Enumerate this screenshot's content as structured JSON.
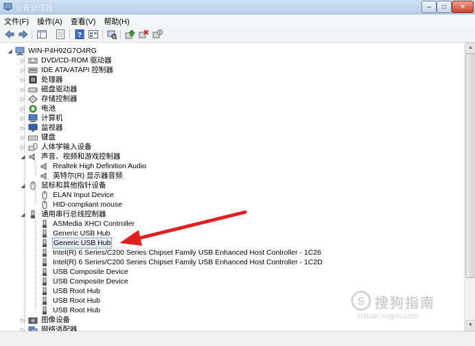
{
  "window": {
    "title": "设备管理器",
    "controls": {
      "minimize": "–",
      "maximize": "□",
      "close": "✕"
    }
  },
  "menu": [
    "文件(F)",
    "操作(A)",
    "查看(V)",
    "帮助(H)"
  ],
  "toolbar_icons": [
    "back-arrow-icon",
    "forward-arrow-icon",
    "console-tree-icon",
    "properties-icon",
    "help-icon",
    "view-icon",
    "scan-hardware-icon",
    "update-driver-icon",
    "uninstall-icon",
    "disable-icon"
  ],
  "tree": {
    "root": "WIN-P4H92G7O4RG",
    "categories": [
      {
        "label": "DVD/CD-ROM 驱动器",
        "icon": "dvd-drive-icon"
      },
      {
        "label": "IDE ATA/ATAPI 控制器",
        "icon": "ide-controller-icon"
      },
      {
        "label": "处理器",
        "icon": "processor-icon"
      },
      {
        "label": "磁盘驱动器",
        "icon": "disk-drive-icon"
      },
      {
        "label": "存储控制器",
        "icon": "storage-controller-icon"
      },
      {
        "label": "电池",
        "icon": "battery-icon"
      },
      {
        "label": "计算机",
        "icon": "computer-icon"
      },
      {
        "label": "监视器",
        "icon": "monitor-icon"
      },
      {
        "label": "键盘",
        "icon": "keyboard-icon"
      },
      {
        "label": "人体学输入设备",
        "icon": "hid-icon"
      },
      {
        "label": "声音、视频和游戏控制器",
        "icon": "sound-icon",
        "children": [
          "Realtek High Definition Audio",
          "英特尔(R) 显示器音频"
        ]
      },
      {
        "label": "鼠标和其他指针设备",
        "icon": "mouse-icon",
        "children": [
          "ELAN Input Device",
          "HID-compliant mouse"
        ]
      },
      {
        "label": "通用串行总线控制器",
        "icon": "usb-icon",
        "children": [
          "ASMedia XHCI Controller",
          "Generic USB Hub",
          "Generic USB Hub",
          "Intel(R) 6 Series/C200 Series Chipset Family USB Enhanced Host Controller - 1C26",
          "Intel(R) 6 Series/C200 Series Chipset Family USB Enhanced Host Controller - 1C2D",
          "USB Composite Device",
          "USB Composite Device",
          "USB Root Hub",
          "USB Root Hub",
          "USB Root Hub"
        ]
      },
      {
        "label": "图像设备",
        "icon": "imaging-icon"
      },
      {
        "label": "网络适配器",
        "icon": "network-icon"
      }
    ]
  },
  "watermark": {
    "brand": "搜狗指南",
    "url": "zhinan.sogou.com"
  },
  "colors": {
    "annotation_arrow": "#e02020",
    "selection_border": "#3a6db5"
  }
}
